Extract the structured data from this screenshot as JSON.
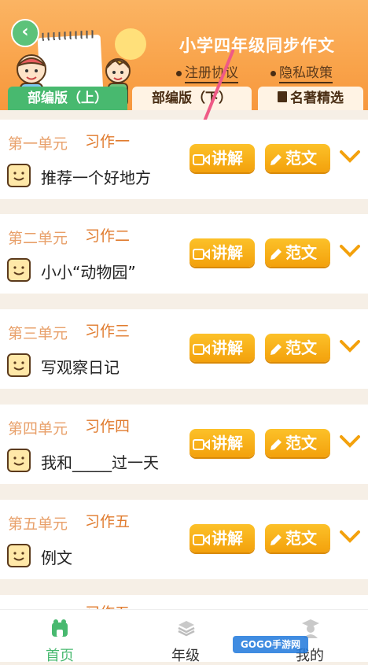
{
  "header": {
    "title": "小学四年级同步作文",
    "policy_a": "注册协议",
    "policy_b": "隐私政策",
    "back_icon": "chevron-left-icon"
  },
  "tabs": [
    {
      "label": "部编版（上）",
      "active": true
    },
    {
      "label": "部编版（下）",
      "active": false
    },
    {
      "label": "名著精选",
      "active": false
    }
  ],
  "buttons": {
    "explain": "讲解",
    "sample": "范文"
  },
  "items": [
    {
      "unit": "第一单元",
      "task": "习作一",
      "topic": "推荐一个好地方"
    },
    {
      "unit": "第二单元",
      "task": "习作二",
      "topic": "小小“动物园”"
    },
    {
      "unit": "第三单元",
      "task": "习作三",
      "topic": "写观察日记"
    },
    {
      "unit": "第四单元",
      "task": "习作四",
      "topic": "我和_____过一天"
    },
    {
      "unit": "第五单元",
      "task": "习作五",
      "topic": "例文"
    }
  ],
  "partial_item": {
    "task": "习作五"
  },
  "nav": {
    "home": "首页",
    "grade": "年级",
    "mine": "我的"
  },
  "watermark": "GOGO手游网",
  "colors": {
    "accent_orange": "#f9a34a",
    "active_green": "#48b96f",
    "button_gold": "#f3a10c"
  }
}
